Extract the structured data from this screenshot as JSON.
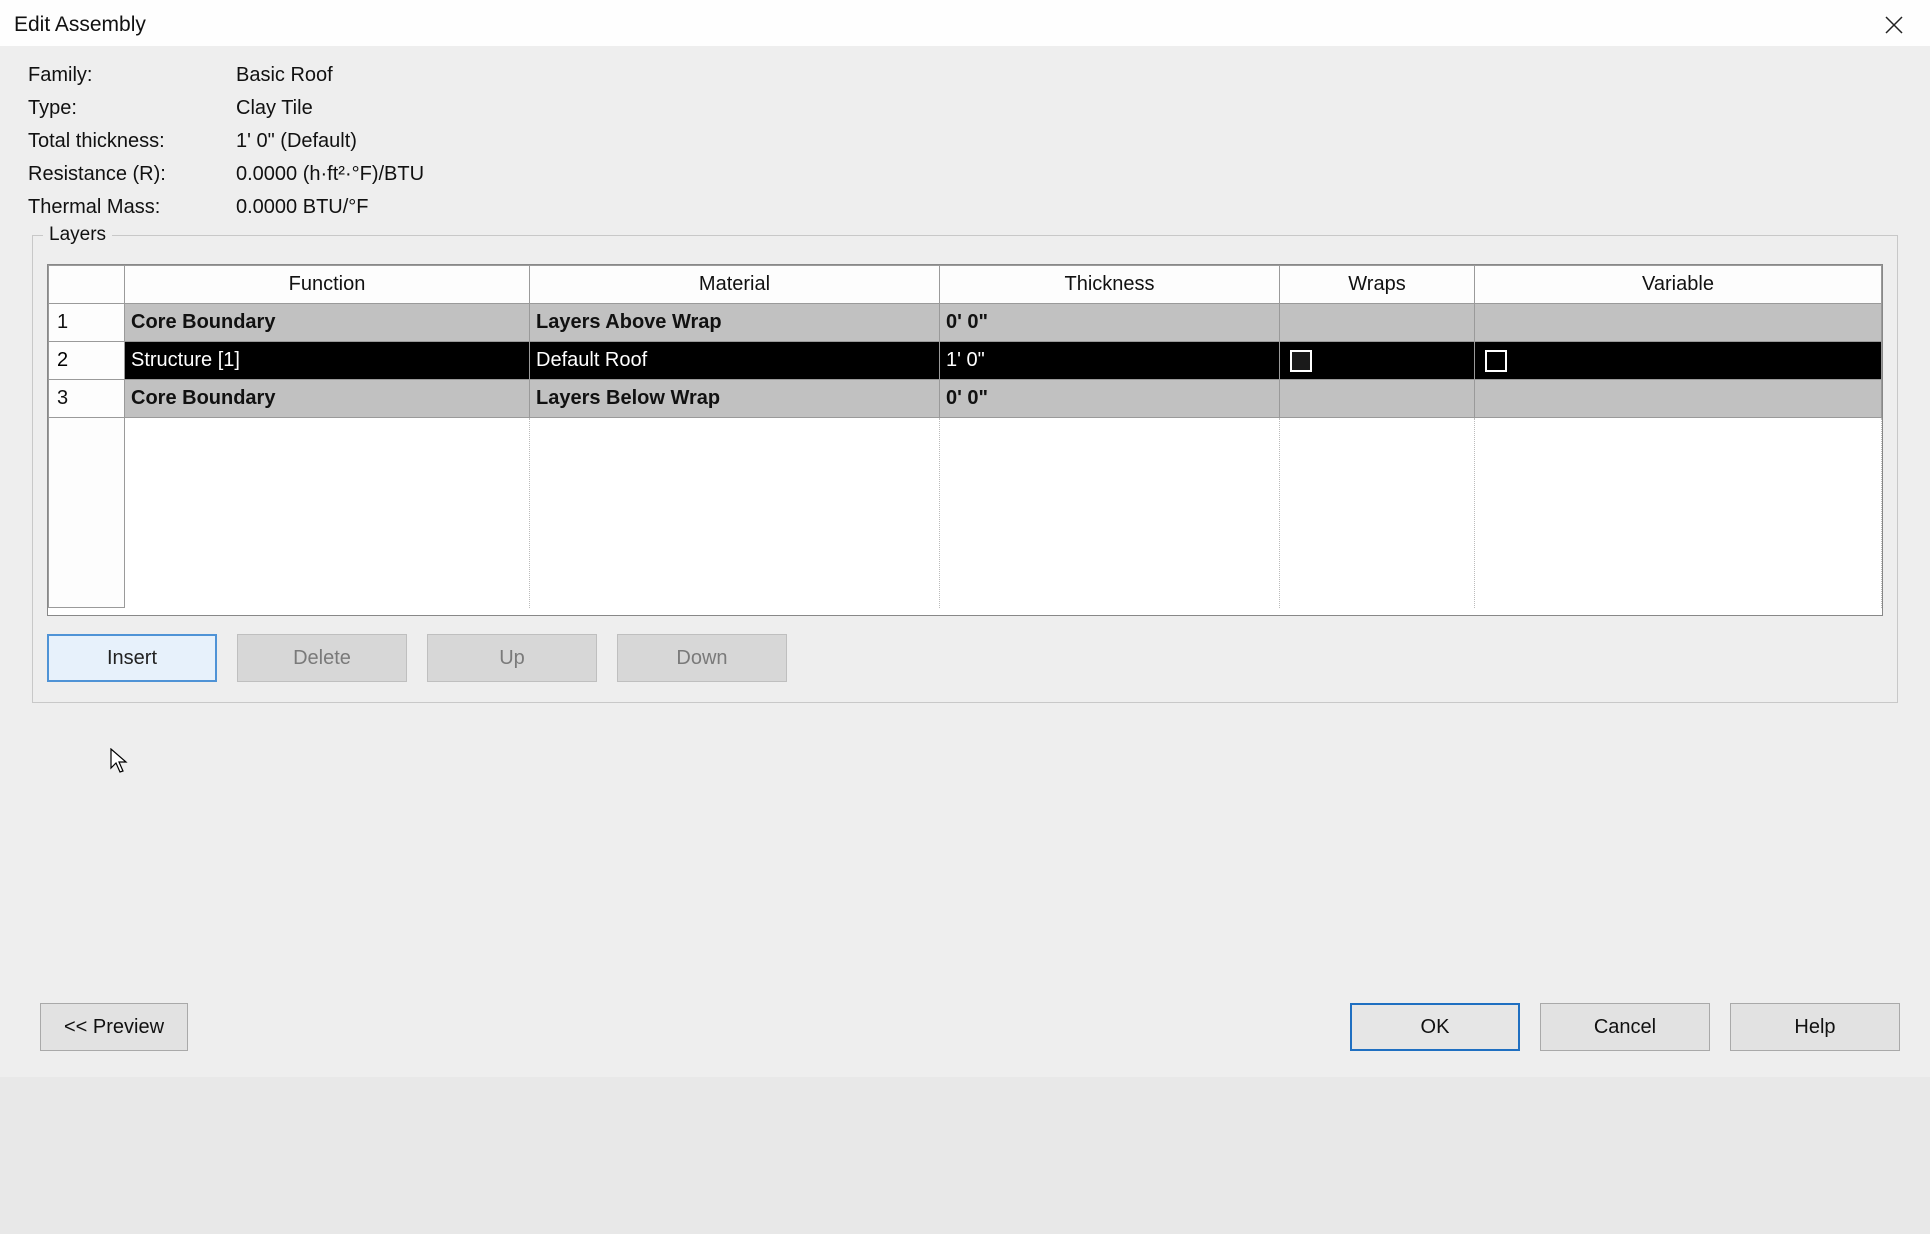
{
  "window": {
    "title": "Edit Assembly"
  },
  "props": {
    "family_label": "Family:",
    "family_value": "Basic Roof",
    "type_label": "Type:",
    "type_value": "Clay Tile",
    "thickness_label": "Total thickness:",
    "thickness_value": "1'  0\" (Default)",
    "resistance_label": "Resistance (R):",
    "resistance_value": "0.0000 (h·ft²·°F)/BTU",
    "thermal_label": "Thermal Mass:",
    "thermal_value": "0.0000 BTU/°F"
  },
  "layers_section": {
    "legend": "Layers",
    "headers": {
      "function": "Function",
      "material": "Material",
      "thickness": "Thickness",
      "wraps": "Wraps",
      "variable": "Variable"
    },
    "rows": [
      {
        "num": "1",
        "function": "Core Boundary",
        "material": "Layers Above Wrap",
        "thickness": "0'  0\"",
        "boundary": true
      },
      {
        "num": "2",
        "function": "Structure [1]",
        "material": "Default Roof",
        "thickness": "1'  0\"",
        "selected": true,
        "variable_checked": false
      },
      {
        "num": "3",
        "function": "Core Boundary",
        "material": "Layers Below Wrap",
        "thickness": "0'  0\"",
        "boundary": true
      }
    ]
  },
  "buttons": {
    "insert": "Insert",
    "delete": "Delete",
    "up": "Up",
    "down": "Down",
    "preview": "<<  Preview",
    "ok": "OK",
    "cancel": "Cancel",
    "help": "Help"
  }
}
